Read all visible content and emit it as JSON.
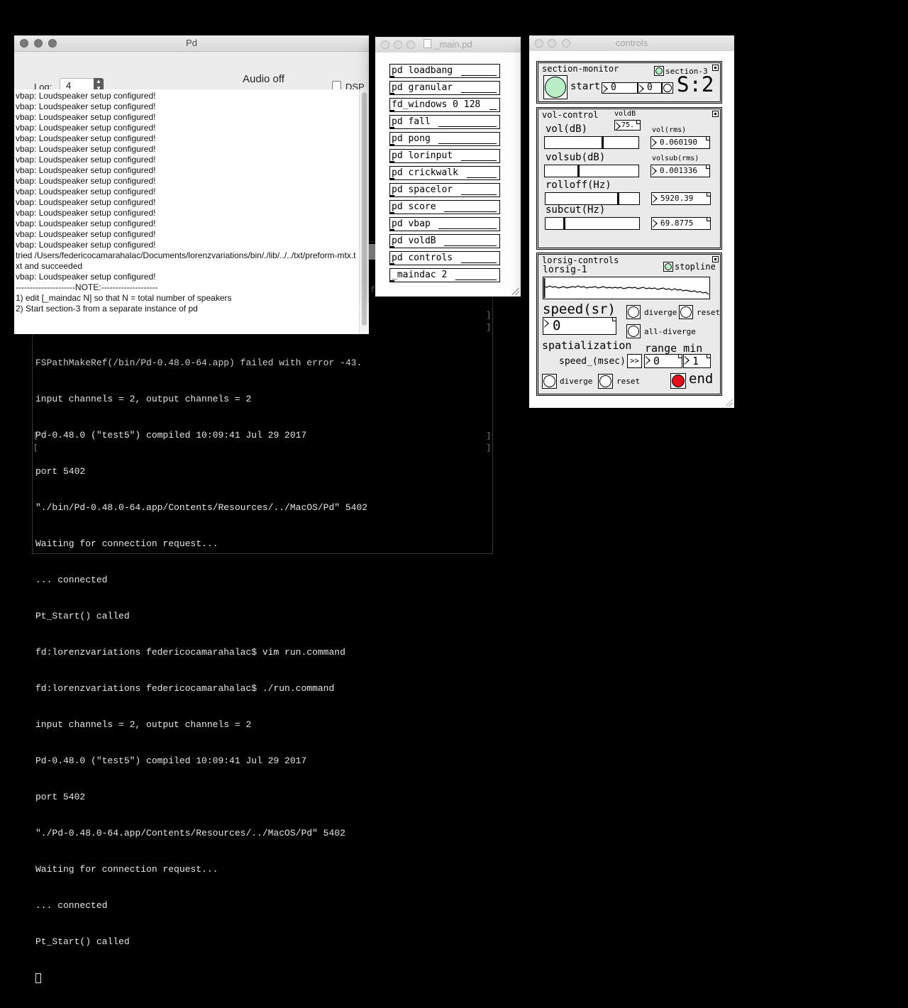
{
  "terminal": {
    "stub_f": "f",
    "lines": [
      "FSPathMakeRef(/bin/Pd-0.48.0-64.app) failed with error -43.",
      "input channels = 2, output channels = 2",
      "Pd-0.48.0 (\"test5\") compiled 10:09:41 Jul 29 2017",
      "port 5402",
      "\"./bin/Pd-0.48.0-64.app/Contents/Resources/../MacOS/Pd\" 5402",
      "Waiting for connection request...",
      "... connected",
      "Pt_Start() called",
      "fd:lorenzvariations federicocamarahalac$ vim run.command",
      "fd:lorenzvariations federicocamarahalac$ ./run.command",
      "input channels = 2, output channels = 2",
      "Pd-0.48.0 (\"test5\") compiled 10:09:41 Jul 29 2017",
      "port 5402",
      "\"./Pd-0.48.0-64.app/Contents/Resources/../MacOS/Pd\" 5402",
      "Waiting for connection request...",
      "... connected",
      "Pt_Start() called"
    ]
  },
  "pd_window": {
    "title": "Pd",
    "log_label": "Log:",
    "log_value": "4",
    "audio_status": "Audio off",
    "dsp_label": "DSP",
    "dsp_checked": false,
    "console_lines": [
      "vbap: Loudspeaker setup configured!",
      "vbap: Loudspeaker setup configured!",
      "vbap: Loudspeaker setup configured!",
      "vbap: Loudspeaker setup configured!",
      "vbap: Loudspeaker setup configured!",
      "vbap: Loudspeaker setup configured!",
      "vbap: Loudspeaker setup configured!",
      "vbap: Loudspeaker setup configured!",
      "vbap: Loudspeaker setup configured!",
      "vbap: Loudspeaker setup configured!",
      "vbap: Loudspeaker setup configured!",
      "vbap: Loudspeaker setup configured!",
      "vbap: Loudspeaker setup configured!",
      "vbap: Loudspeaker setup configured!",
      "vbap: Loudspeaker setup configured!",
      "tried /Users/federicocamarahalac/Documents/lorenzvariations/bin/./lib/../../txt/preform-mtx.txt and succeeded",
      "vbap: Loudspeaker setup configured!",
      "---------------------NOTE:--------------------",
      "1) edit [_maindac N] so that N = total number of speakers",
      "2) Start section-3 from a separate instance of pd"
    ]
  },
  "main_window": {
    "title": "_main.pd",
    "objects": [
      "pd loadbang",
      "pd granular",
      "fd_windows 0 128",
      "pd fall",
      "pd pong",
      "pd lorinput",
      "pd crickwalk",
      "pd spacelor",
      "pd score",
      "pd vbap",
      "pd voldB",
      "pd controls",
      "_maindac 2"
    ]
  },
  "controls_window": {
    "title": "controls",
    "section_monitor": {
      "header": "section-monitor",
      "section_toggle_label": "section-3",
      "start_label": "start",
      "num_a": "0",
      "num_b": "0",
      "section_display": "S:2"
    },
    "vol_control": {
      "header": "vol-control",
      "voldb_label": "voldB",
      "voldb_value": "75.",
      "vol_db_label": "vol(dB)",
      "vol_rms_label": "vol(rms)",
      "vol_rms_value": "0.060190",
      "volsub_db_label": "volsub(dB)",
      "volsub_rms_label": "volsub(rms)",
      "volsub_rms_value": "0.001336",
      "rolloff_label": "rolloff(Hz)",
      "rolloff_value": "5920.39",
      "subcut_label": "subcut(Hz)",
      "subcut_value": "69.8775",
      "vol_slider_level": 0.62,
      "volsub_slider_level": 0.36,
      "rolloff_slider_level": 0.78,
      "subcut_slider_level": 0.19
    },
    "lorsig_controls": {
      "header": "lorsig-controls",
      "signal_label": "lorsig-1",
      "stopline_label": "stopline",
      "speed_label": "speed(sr)",
      "speed_value": "0",
      "diverge_label": "diverge",
      "reset_label": "reset",
      "all_diverge_label": "all-diverge",
      "spatialization_label": "spatialization",
      "range_min_label": "range min",
      "speed_msec_label": "speed_(msec)",
      "send_button_label": ">>",
      "msec_value": "0",
      "range_min_value": "1",
      "bottom_diverge_label": "diverge",
      "bottom_reset_label": "reset",
      "end_label": "end",
      "end_color": "#e0101c"
    }
  }
}
